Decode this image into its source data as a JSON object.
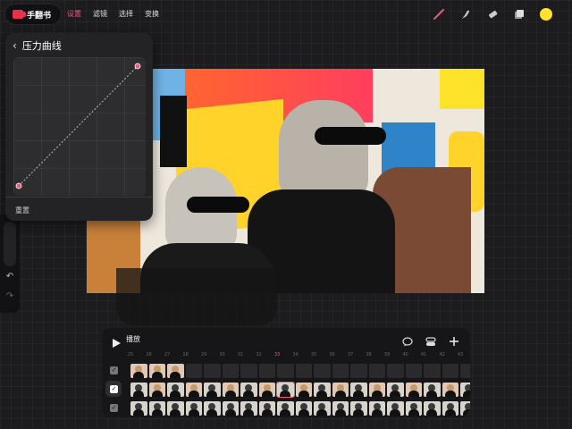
{
  "app": {
    "name": "手翻书"
  },
  "menu": {
    "items": [
      "设置",
      "滤镜",
      "选择",
      "变换"
    ],
    "active_index": 0
  },
  "toolbar": {
    "tools": [
      "brush-icon",
      "smudge-icon",
      "eraser-icon",
      "layers-icon"
    ],
    "current_color": "#ffe32a"
  },
  "curve_panel": {
    "title": "压力曲线",
    "reset_label": "重置",
    "point_color": "#f05a78"
  },
  "timeline": {
    "play_label": "播放",
    "frame_numbers": [
      "25",
      "26",
      "27",
      "28",
      "29",
      "30",
      "31",
      "32",
      "33",
      "34",
      "35",
      "36",
      "37",
      "38",
      "39",
      "40",
      "41",
      "42",
      "43"
    ],
    "current_frame": "33",
    "accent": "#f05a78"
  }
}
